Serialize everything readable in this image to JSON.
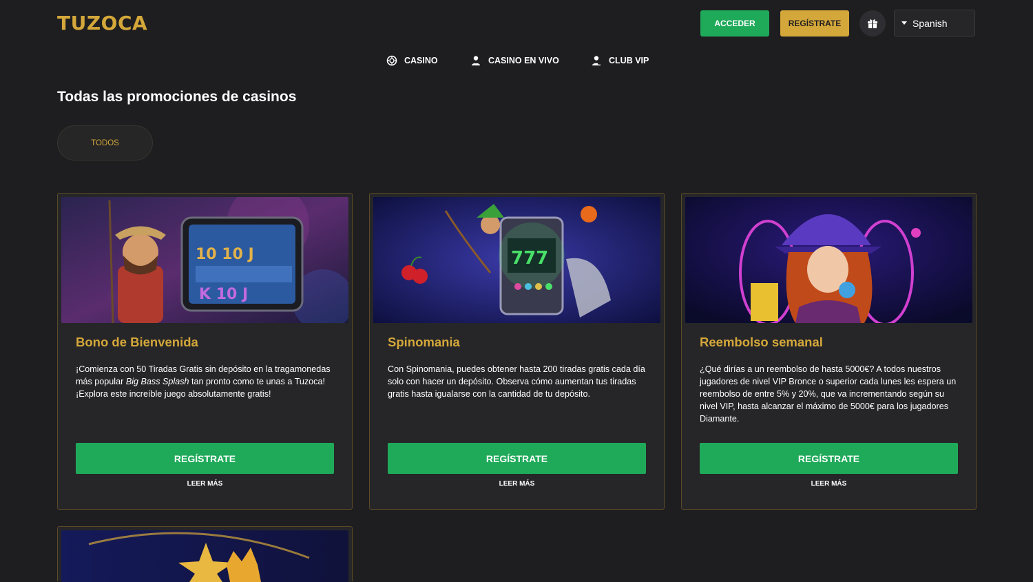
{
  "header": {
    "logo_text": "TUZOCA",
    "acceder_label": "ACCEDER",
    "registrate_label": "REGÍSTRATE",
    "gift_icon": "gift-icon",
    "language": "Spanish"
  },
  "nav": {
    "items": [
      {
        "label": "CASINO",
        "icon": "chip-icon"
      },
      {
        "label": "CASINO EN VIVO",
        "icon": "dealer-icon"
      },
      {
        "label": "CLUB VIP",
        "icon": "vip-user-icon"
      }
    ]
  },
  "main": {
    "title": "Todas las promociones de casinos",
    "filter_label": "TODOS"
  },
  "promotions": [
    {
      "title": "Bono de Bienvenida",
      "desc_before": "¡Comienza con 50 Tiradas Gratis sin depósito en la tragamonedas más popular ",
      "desc_em": "Big Bass Splash",
      "desc_after": " tan pronto como te unas a Tuzoca! ¡Explora este increíble juego absolutamente gratis!",
      "button_label": "REGÍSTRATE",
      "link_label": "LEER MÁS"
    },
    {
      "title": "Spinomania",
      "desc": "Con Spinomania, puedes obtener hasta 200 tiradas gratis cada día solo con hacer un depósito. Observa cómo aumentan tus tiradas gratis hasta igualarse con la cantidad de tu depósito.",
      "button_label": "REGÍSTRATE",
      "link_label": "LEER MÁS"
    },
    {
      "title": "Reembolso semanal",
      "desc": "¿Qué dirías a un reembolso de hasta 5000€? A todos nuestros jugadores de nivel VIP Bronce o superior cada lunes les espera un reembolso de entre 5% y 20%, que va incrementando según su nivel VIP, hasta alcanzar el máximo de 5000€ para los jugadores Diamante.",
      "button_label": "REGÍSTRATE",
      "link_label": "LEER MÁS"
    }
  ],
  "colors": {
    "background": "#1e1e20",
    "card": "#262628",
    "gold": "#d4a73a",
    "green": "#1faa5a"
  }
}
